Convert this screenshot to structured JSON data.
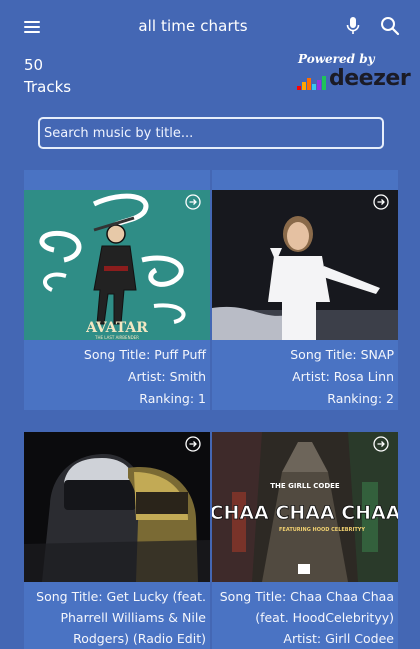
{
  "header": {
    "title": "all time charts",
    "menu_icon": "hamburger-menu-icon",
    "mic_icon": "microphone-icon",
    "search_icon": "search-icon"
  },
  "summary": {
    "count": "50",
    "unit": "Tracks"
  },
  "brand": {
    "powered_by": "Powered by",
    "name": "deezer",
    "bar_colors": [
      "#ff0000",
      "#ffa600",
      "#ff6e00",
      "#38c7ef",
      "#9333e0",
      "#1fc45a"
    ]
  },
  "search": {
    "placeholder": "Search music by title...",
    "value": ""
  },
  "tracks": [
    {
      "song_title": "Song Title: Puff Puff",
      "artist": "Artist: Smith",
      "ranking": "Ranking: 1",
      "art_text": "AVATAR",
      "art_subtext": "THE LAST AIRBENDER"
    },
    {
      "song_title": "Song Title: SNAP",
      "artist": "Artist: Rosa Linn",
      "ranking": "Ranking: 2"
    },
    {
      "song_title_l1": "Song Title: Get Lucky (feat.",
      "song_title_l2": "Pharrell Williams & Nile",
      "song_title_l3": "Rodgers) (Radio Edit)"
    },
    {
      "song_title_l1": "Song Title: Chaa Chaa Chaa",
      "song_title_l2": "(feat. HoodCelebrityy)",
      "artist": "Artist: Girll Codee",
      "art_top": "THE GIRLL CODEE",
      "art_main": "CHAA CHAA CHAA",
      "art_sub": "FEATURING HOOD CELEBRITYY"
    }
  ],
  "colors": {
    "background": "#4467b4",
    "card": "#4a73c3"
  }
}
